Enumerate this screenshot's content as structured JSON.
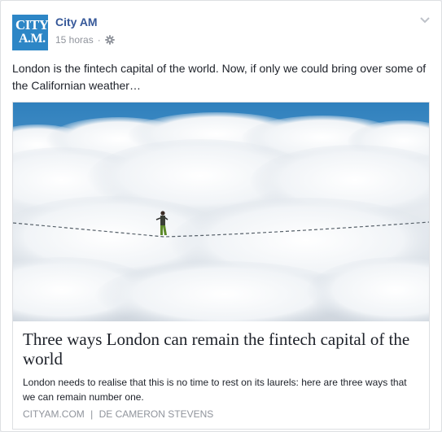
{
  "post": {
    "page_name": "City AM",
    "time": "15 horas",
    "separator": "·",
    "audience_icon": "gear-icon",
    "menu_icon": "chevron-down-icon",
    "text": "London is the fintech capital of the world. Now, if only we could bring over some of the Californian weather…"
  },
  "avatar": {
    "line1": "CITY",
    "line2": "A.M.",
    "color": "#2d86c6"
  },
  "link": {
    "image_description": "tightrope-walker-above-clouds",
    "title": "Three ways London can remain the fintech capital of the world",
    "description": "London needs to realise that this is no time to rest on its laurels: here are three ways that we can remain number one.",
    "source": "CITYAM.COM",
    "divider": "|",
    "author": "DE CAMERON STEVENS"
  },
  "colors": {
    "link_blue": "#365899",
    "meta_gray": "#90949c",
    "text": "#1d2129",
    "border": "#dddfe2"
  }
}
